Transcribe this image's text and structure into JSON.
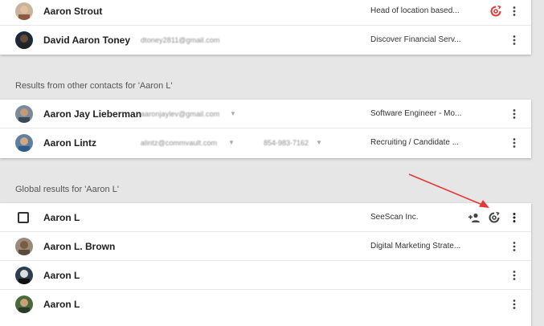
{
  "top_results": [
    {
      "name": "Aaron Strout",
      "email": "",
      "title": "Head of location based...",
      "has_sync_icon": true
    },
    {
      "name": "David Aaron Toney",
      "email": "dtoney2811@gmail.com",
      "title": "Discover Financial Serv...",
      "has_sync_icon": false
    }
  ],
  "other_contacts": {
    "label": "Results from other contacts for 'Aaron L'",
    "rows": [
      {
        "name": "Aaron Jay Lieberman",
        "email": "aaronjaylev@gmail.com",
        "phone": "",
        "title": "Software Engineer - Mo..."
      },
      {
        "name": "Aaron Lintz",
        "email": "alintz@commvault.com",
        "phone": "854-983-7162",
        "title": "Recruiting / Candidate ..."
      }
    ]
  },
  "global_results": {
    "label": "Global results for 'Aaron L'",
    "rows": [
      {
        "name": "Aaron L",
        "title": "SeeScan Inc."
      },
      {
        "name": "Aaron L. Brown",
        "title": "Digital Marketing Strate..."
      },
      {
        "name": "Aaron L",
        "title": ""
      },
      {
        "name": "Aaron L",
        "title": ""
      }
    ]
  },
  "colors": {
    "accent_red": "#e53935",
    "background": "#e6e6e6",
    "card": "#ffffff"
  },
  "icons": [
    "more-vert-icon",
    "sync-icon",
    "add-person-icon",
    "arrow-annotation"
  ]
}
